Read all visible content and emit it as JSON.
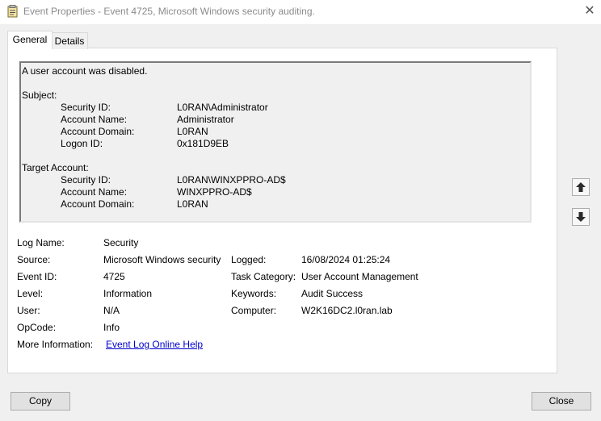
{
  "window": {
    "title": "Event Properties - Event 4725, Microsoft Windows security auditing.",
    "close_glyph": "✕"
  },
  "tabs": [
    {
      "label": "General",
      "selected": true
    },
    {
      "label": "Details",
      "selected": false
    }
  ],
  "description": {
    "summary": "A user account was disabled.",
    "subject_heading": "Subject:",
    "subject_fields": [
      {
        "label": "Security ID:",
        "value": "L0RAN\\Administrator"
      },
      {
        "label": "Account Name:",
        "value": "Administrator"
      },
      {
        "label": "Account Domain:",
        "value": "L0RAN"
      },
      {
        "label": "Logon ID:",
        "value": "0x181D9EB"
      }
    ],
    "target_heading": "Target Account:",
    "target_fields": [
      {
        "label": "Security ID:",
        "value": "L0RAN\\WINXPPRO-AD$"
      },
      {
        "label": "Account Name:",
        "value": "WINXPPRO-AD$"
      },
      {
        "label": "Account Domain:",
        "value": "L0RAN"
      }
    ]
  },
  "fields": {
    "log_name": {
      "label": "Log Name:",
      "value": "Security"
    },
    "source": {
      "label": "Source:",
      "value": "Microsoft Windows security"
    },
    "logged": {
      "label": "Logged:",
      "value": "16/08/2024 01:25:24"
    },
    "event_id": {
      "label": "Event ID:",
      "value": "4725"
    },
    "task_category": {
      "label": "Task Category:",
      "value": "User Account Management"
    },
    "level": {
      "label": "Level:",
      "value": "Information"
    },
    "keywords": {
      "label": "Keywords:",
      "value": "Audit Success"
    },
    "user": {
      "label": "User:",
      "value": "N/A"
    },
    "computer": {
      "label": "Computer:",
      "value": "W2K16DC2.l0ran.lab"
    },
    "opcode": {
      "label": "OpCode:",
      "value": "Info"
    },
    "more_info": {
      "label": "More Information:",
      "value": "Event Log Online Help"
    }
  },
  "buttons": {
    "copy": "Copy",
    "close": "Close"
  },
  "icons": {
    "app": "event-viewer-icon",
    "scroll_up": "up-arrow-icon",
    "scroll_down": "down-arrow-icon"
  },
  "colors": {
    "link": "#0000cc",
    "title_text": "#8a8a8a"
  }
}
